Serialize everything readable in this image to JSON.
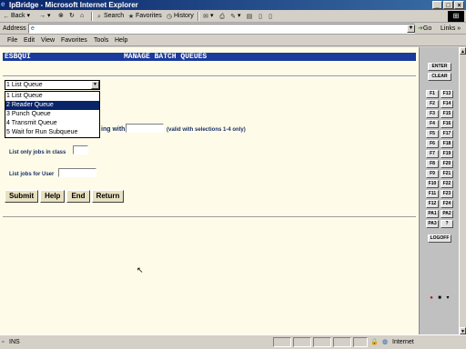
{
  "window": {
    "title": "IpBridge - Microsoft Internet Explorer",
    "controls": [
      "_",
      "□",
      "×"
    ]
  },
  "toolbar": {
    "back": "Back",
    "forward": "→",
    "stop": "⊗",
    "refresh": "↻",
    "home": "⌂",
    "search": "Search",
    "favorites": "Favorites",
    "history": "History"
  },
  "address": {
    "label": "Address",
    "value": "",
    "go": "Go",
    "links": "Links"
  },
  "menu": [
    "File",
    "Edit",
    "View",
    "Favorites",
    "Tools",
    "Help"
  ],
  "screen": {
    "code": "ESBQUI",
    "title": "MANAGE BATCH QUEUES",
    "queue_selected": "1 List Queue",
    "queue_options": [
      "1 List Queue",
      "2 Reader Queue",
      "3 Punch Queue",
      "4 Transmit Queue",
      "5 Wait for Run Subqueue"
    ],
    "highlighted_option": 1,
    "starting_with_label": "ing with",
    "starting_with_value": "",
    "valid_note": "(valid with selections 1-4 only)",
    "class_label": "List only jobs in class",
    "class_value": "",
    "user_label": "List jobs for User",
    "user_value": "",
    "buttons": {
      "submit": "Submit",
      "help": "Help",
      "end": "End",
      "return": "Return"
    }
  },
  "pf_panel": {
    "enter": "ENTER",
    "clear": "CLEAR",
    "keys": [
      [
        "F1",
        "F13"
      ],
      [
        "F2",
        "F14"
      ],
      [
        "F3",
        "F15"
      ],
      [
        "F4",
        "F16"
      ],
      [
        "F5",
        "F17"
      ],
      [
        "F6",
        "F18"
      ],
      [
        "F7",
        "F19"
      ],
      [
        "F8",
        "F20"
      ],
      [
        "F9",
        "F21"
      ],
      [
        "F10",
        "F22"
      ],
      [
        "F11",
        "F23"
      ],
      [
        "F12",
        "F24"
      ],
      [
        "PA1",
        "PA2"
      ],
      [
        "PA3",
        "?"
      ]
    ],
    "logoff": "LOGOFF",
    "indicators": [
      "●",
      "■",
      "▾"
    ],
    "indicator_colors": [
      "#cc0000",
      "#000000",
      "#000000"
    ]
  },
  "status": {
    "text": "INS",
    "zone": "Internet"
  }
}
